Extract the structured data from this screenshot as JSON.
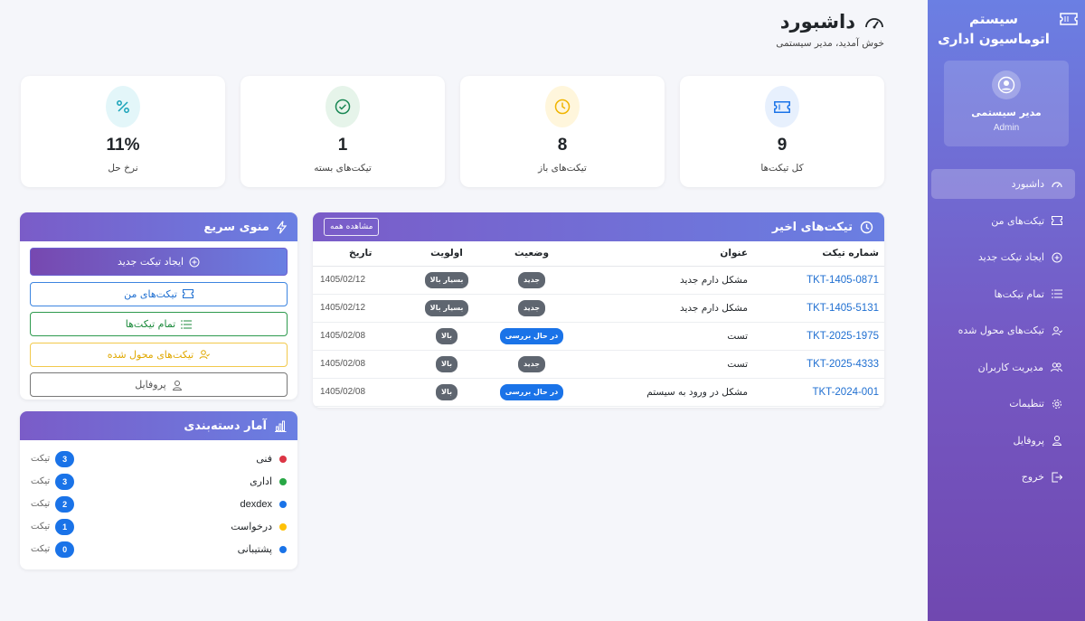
{
  "sidebar": {
    "brand": "سیستم اتوماسیون اداری",
    "user_name": "مدیر سیستمی",
    "user_role": "Admin",
    "items": [
      {
        "label": "داشبورد",
        "icon": "speedometer-icon",
        "active": true
      },
      {
        "label": "تیکت‌های من",
        "icon": "ticket-icon"
      },
      {
        "label": "ایجاد تیکت جدید",
        "icon": "plus-circle-icon"
      },
      {
        "label": "تمام تیکت‌ها",
        "icon": "list-icon"
      },
      {
        "label": "تیکت‌های محول شده",
        "icon": "user-check-icon"
      },
      {
        "label": "مدیریت کاربران",
        "icon": "users-icon"
      },
      {
        "label": "تنظیمات",
        "icon": "gear-icon"
      },
      {
        "label": "پروفایل",
        "icon": "person-icon"
      },
      {
        "label": "خروج",
        "icon": "logout-icon"
      }
    ]
  },
  "header": {
    "title": "داشبورد",
    "subtitle": "خوش آمدید، مدیر سیستمی"
  },
  "stats": [
    {
      "value": "9",
      "label": "کل تیکت‌ها",
      "icon": "ticket-icon",
      "color": "#1a73e8",
      "bg": "#e7f0fd"
    },
    {
      "value": "8",
      "label": "تیکت‌های باز",
      "icon": "clock-icon",
      "color": "#f0b400",
      "bg": "#fff6dc"
    },
    {
      "value": "1",
      "label": "تیکت‌های بسته",
      "icon": "check-circle-icon",
      "color": "#198754",
      "bg": "#e6f4ea"
    },
    {
      "value": "11%",
      "label": "نرخ حل",
      "icon": "percent-icon",
      "color": "#17a2b8",
      "bg": "#e3f6f9"
    }
  ],
  "recent": {
    "title": "تیکت‌های اخیر",
    "view_all": "مشاهده همه",
    "columns": [
      "شماره تیکت",
      "عنوان",
      "وضعیت",
      "اولویت",
      "تاریخ"
    ],
    "rows": [
      {
        "num": "TKT-1405-0871",
        "title": "مشکل دارم جدید",
        "status": "جدید",
        "status_color": "#6c757d",
        "priority": "بسیار بالا",
        "date": "1405/02/12"
      },
      {
        "num": "TKT-1405-5131",
        "title": "مشکل دارم جدید",
        "status": "جدید",
        "status_color": "#6c757d",
        "priority": "بسیار بالا",
        "date": "1405/02/12"
      },
      {
        "num": "TKT-2025-1975",
        "title": "تست",
        "status": "در حال بررسی",
        "status_color": "#1a73e8",
        "priority": "بالا",
        "date": "1405/02/08"
      },
      {
        "num": "TKT-2025-4333",
        "title": "تست",
        "status": "جدید",
        "status_color": "#6c757d",
        "priority": "بالا",
        "date": "1405/02/08"
      },
      {
        "num": "TKT-2024-001",
        "title": "مشکل در ورود به سیستم",
        "status": "در حال بررسی",
        "status_color": "#1a73e8",
        "priority": "بالا",
        "date": "1405/02/08"
      }
    ]
  },
  "quick": {
    "title": "منوی سریع",
    "buttons": [
      {
        "label": "ایجاد تیکت جدید",
        "icon": "plus-circle-icon"
      },
      {
        "label": "تیکت‌های من",
        "icon": "ticket-icon"
      },
      {
        "label": "تمام تیکت‌ها",
        "icon": "list-icon"
      },
      {
        "label": "تیکت‌های محول شده",
        "icon": "user-check-icon"
      },
      {
        "label": "پروفایل",
        "icon": "person-icon"
      }
    ]
  },
  "categories": {
    "title": "آمار دسته‌بندی",
    "unit": "تیکت",
    "items": [
      {
        "name": "فنی",
        "count": "3",
        "color": "#dc3545"
      },
      {
        "name": "اداری",
        "count": "3",
        "color": "#28a745"
      },
      {
        "name": "dexdex",
        "count": "2",
        "color": "#1a73e8"
      },
      {
        "name": "درخواست",
        "count": "1",
        "color": "#ffc107"
      },
      {
        "name": "پشتیبانی",
        "count": "0",
        "color": "#1a73e8"
      }
    ]
  }
}
